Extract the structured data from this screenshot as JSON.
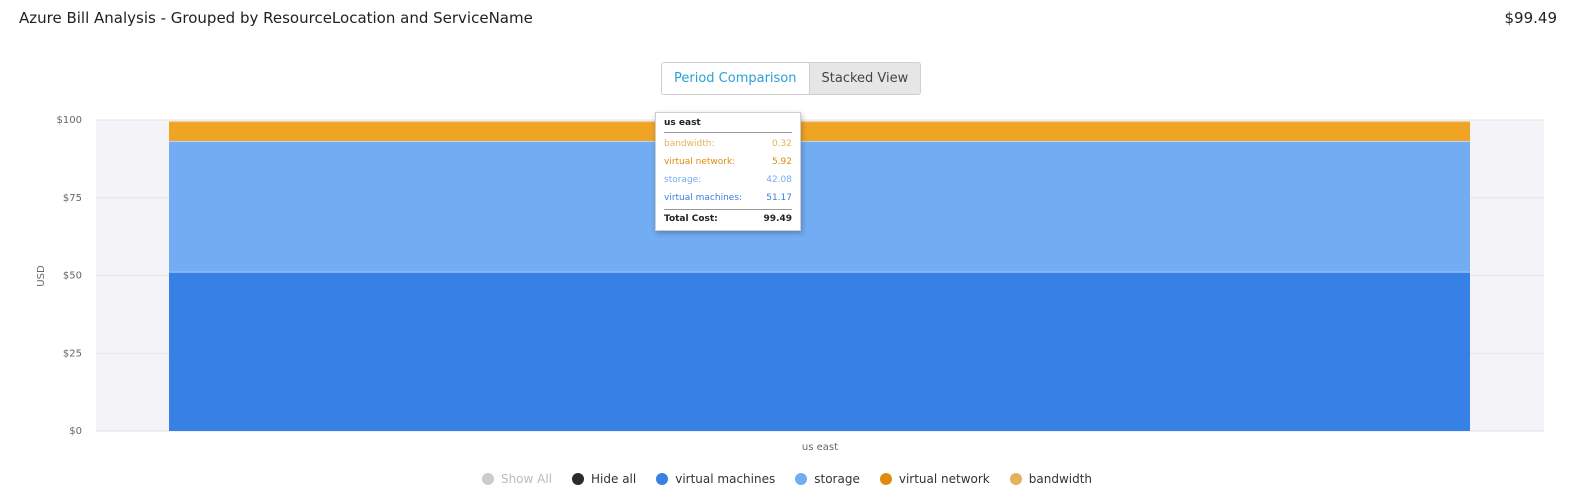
{
  "header": {
    "title": "Azure Bill Analysis - Grouped by ResourceLocation and ServiceName",
    "total": "$99.49"
  },
  "toggle": {
    "period_label": "Period Comparison",
    "stacked_label": "Stacked View"
  },
  "colors": {
    "virtual_machines": "#3780e6",
    "storage": "#72acf3",
    "virtual_network": "#de8c0a",
    "bandwidth": "#e3b25a",
    "stacked_top": "#f0a424",
    "plot_bg": "#f4f4f8"
  },
  "chart_data": {
    "type": "bar",
    "stacked": true,
    "categories": [
      "us east"
    ],
    "series": [
      {
        "name": "virtual machines",
        "values": [
          51.17
        ]
      },
      {
        "name": "storage",
        "values": [
          42.08
        ]
      },
      {
        "name": "virtual network",
        "values": [
          5.92
        ]
      },
      {
        "name": "bandwidth",
        "values": [
          0.32
        ]
      }
    ],
    "ylabel": "USD",
    "ylim": [
      0,
      100
    ],
    "yticks": [
      "$0",
      "$25",
      "$50",
      "$75",
      "$100"
    ],
    "grid": true,
    "legend": "bottom"
  },
  "tooltip": {
    "title": "us east",
    "rows": [
      {
        "label": "bandwidth:",
        "value": "0.32"
      },
      {
        "label": "virtual network:",
        "value": "5.92"
      },
      {
        "label": "storage:",
        "value": "42.08"
      },
      {
        "label": "virtual machines:",
        "value": "51.17"
      }
    ],
    "total_label": "Total Cost:",
    "total_value": "99.49"
  },
  "legend": {
    "show_all": "Show All",
    "hide_all": "Hide all",
    "items": [
      "virtual machines",
      "storage",
      "virtual network",
      "bandwidth"
    ]
  }
}
